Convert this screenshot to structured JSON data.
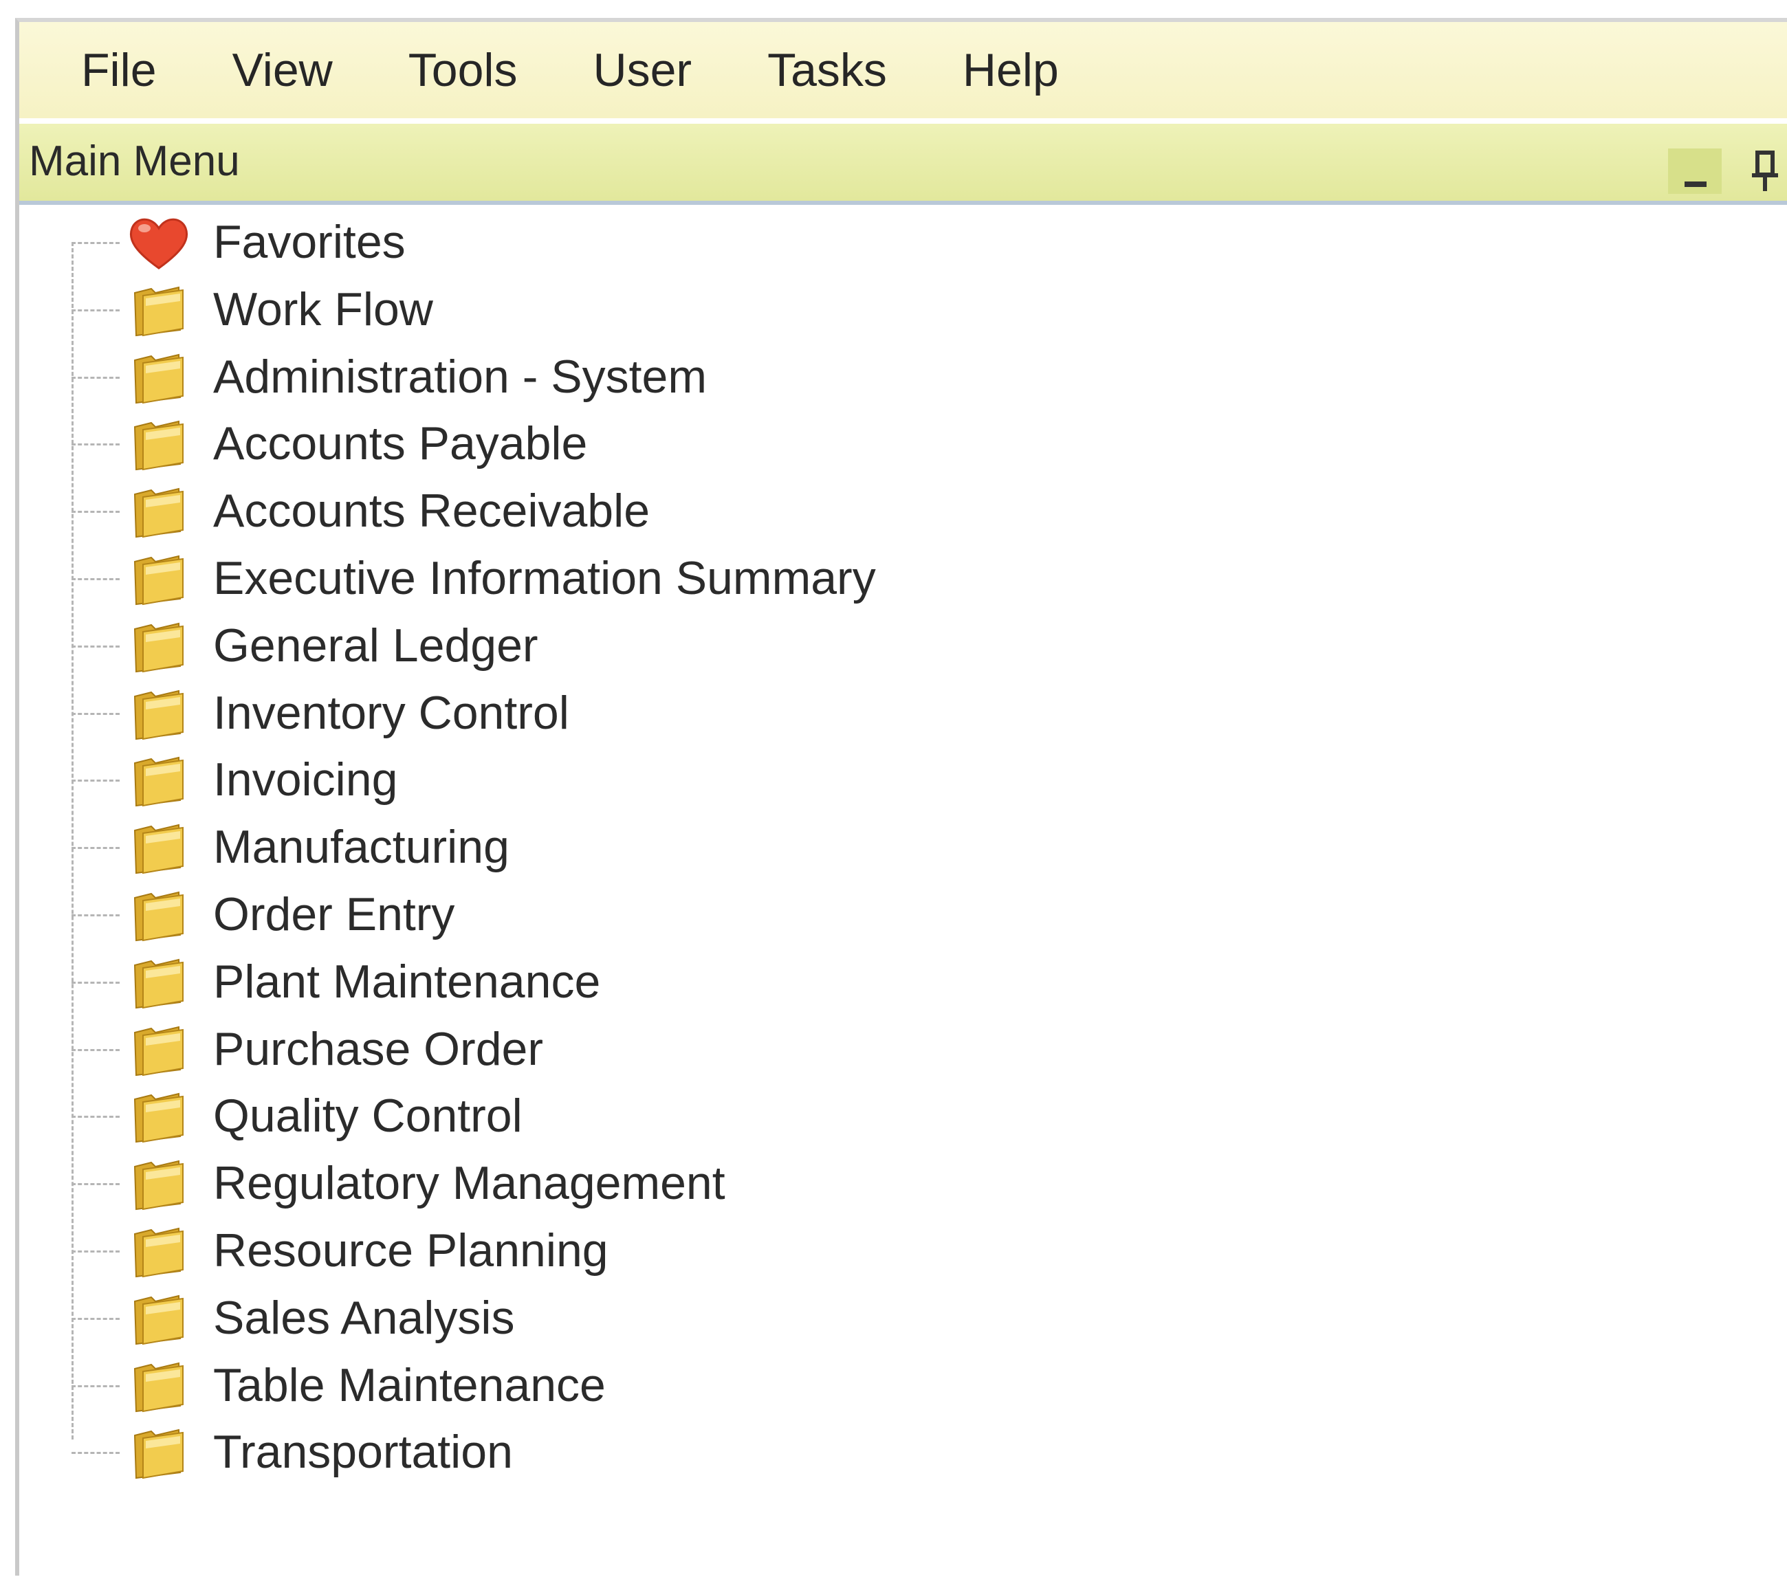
{
  "menubar": {
    "items": [
      "File",
      "View",
      "Tools",
      "User",
      "Tasks",
      "Help"
    ]
  },
  "panel": {
    "title": "Main Menu"
  },
  "tree": {
    "items": [
      {
        "label": "Favorites",
        "icon": "heart-icon"
      },
      {
        "label": "Work Flow",
        "icon": "folder-icon"
      },
      {
        "label": "Administration - System",
        "icon": "folder-icon"
      },
      {
        "label": "Accounts Payable",
        "icon": "folder-icon"
      },
      {
        "label": "Accounts Receivable",
        "icon": "folder-icon"
      },
      {
        "label": "Executive Information Summary",
        "icon": "folder-icon"
      },
      {
        "label": "General Ledger",
        "icon": "folder-icon"
      },
      {
        "label": "Inventory Control",
        "icon": "folder-icon"
      },
      {
        "label": "Invoicing",
        "icon": "folder-icon"
      },
      {
        "label": "Manufacturing",
        "icon": "folder-icon"
      },
      {
        "label": "Order Entry",
        "icon": "folder-icon"
      },
      {
        "label": "Plant Maintenance",
        "icon": "folder-icon"
      },
      {
        "label": "Purchase Order",
        "icon": "folder-icon"
      },
      {
        "label": "Quality Control",
        "icon": "folder-icon"
      },
      {
        "label": "Regulatory Management",
        "icon": "folder-icon"
      },
      {
        "label": "Resource Planning",
        "icon": "folder-icon"
      },
      {
        "label": "Sales Analysis",
        "icon": "folder-icon"
      },
      {
        "label": "Table Maintenance",
        "icon": "folder-icon"
      },
      {
        "label": "Transportation",
        "icon": "folder-icon"
      }
    ]
  },
  "colors": {
    "menubar_bg": "#f6f2c4",
    "titlebar_bg": "#e2e89c",
    "heart": "#e8482e",
    "folder": "#f2cc4e"
  }
}
